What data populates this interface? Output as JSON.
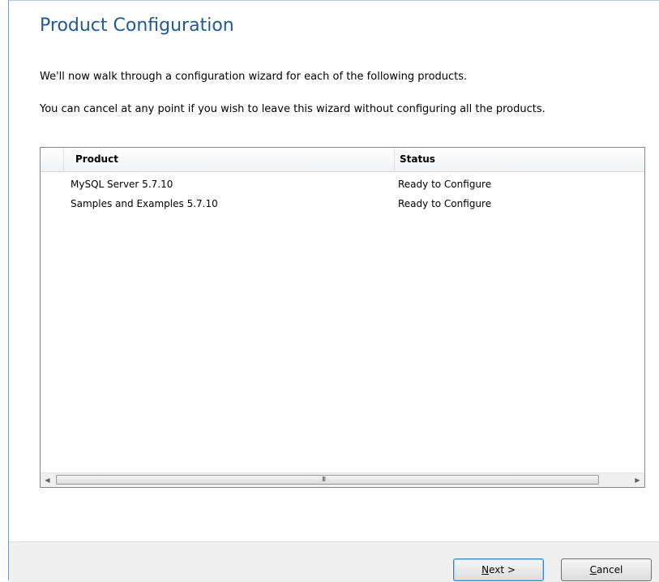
{
  "page": {
    "title": "Product Configuration",
    "intro_line1": "We'll now walk through a configuration wizard for each of the following products.",
    "intro_line2": "You can cancel at any point if you wish to leave this wizard without configuring all the products."
  },
  "grid": {
    "columns": [
      "Product",
      "Status"
    ],
    "rows": [
      {
        "product": "MySQL Server 5.7.10",
        "status": "Ready to Configure"
      },
      {
        "product": "Samples and Examples 5.7.10",
        "status": "Ready to Configure"
      }
    ],
    "scroll_left_icon": "◀",
    "scroll_right_icon": "▶",
    "thumb_grip": "III"
  },
  "footer": {
    "next": {
      "mnemonic": "N",
      "rest": "ext >"
    },
    "cancel": {
      "mnemonic": "C",
      "rest": "ancel"
    }
  }
}
